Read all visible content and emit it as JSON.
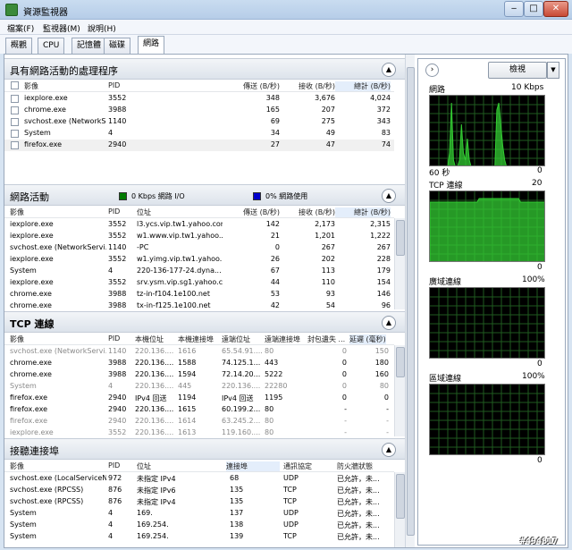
{
  "window": {
    "title": "資源監視器",
    "min": "‒",
    "max": "□",
    "close": "✕"
  },
  "menu": [
    "檔案(F)",
    "監視器(M)",
    "說明(H)"
  ],
  "tabs": [
    "概觀",
    "CPU",
    "記憶體",
    "磁碟",
    "網路"
  ],
  "sections": {
    "processes": {
      "title": "具有網路活動的處理程序",
      "columns": [
        "影像",
        "PID",
        "傳送 (B/秒)",
        "接收 (B/秒)",
        "總計 (B/秒)"
      ],
      "rows": [
        [
          "iexplore.exe",
          "3552",
          "348",
          "3,676",
          "4,024"
        ],
        [
          "chrome.exe",
          "3988",
          "165",
          "207",
          "372"
        ],
        [
          "svchost.exe (NetworkSe...",
          "1140",
          "69",
          "275",
          "343"
        ],
        [
          "System",
          "4",
          "34",
          "49",
          "83"
        ],
        [
          "firefox.exe",
          "2940",
          "27",
          "47",
          "74"
        ]
      ]
    },
    "network": {
      "title": "網路活動",
      "legend_io": "0 Kbps 網路 I/O",
      "legend_util": "0% 網路使用",
      "columns": [
        "影像",
        "PID",
        "位址",
        "傳送 (B/秒)",
        "接收 (B/秒)",
        "總計 (B/秒)"
      ],
      "rows": [
        [
          "iexplore.exe",
          "3552",
          "l3.ycs.vip.tw1.yahoo.com",
          "142",
          "2,173",
          "2,315"
        ],
        [
          "iexplore.exe",
          "3552",
          "w1.www.vip.tw1.yahoo....",
          "21",
          "1,201",
          "1,222"
        ],
        [
          "svchost.exe (NetworkServi...",
          "1140",
          "-PC",
          "0",
          "267",
          "267"
        ],
        [
          "iexplore.exe",
          "3552",
          "w1.yimg.vip.tw1.yahoo....",
          "26",
          "202",
          "228"
        ],
        [
          "System",
          "4",
          "220-136-177-24.dyna...",
          "67",
          "113",
          "179"
        ],
        [
          "iexplore.exe",
          "3552",
          "srv.ysm.vip.sg1.yahoo.c...",
          "44",
          "110",
          "154"
        ],
        [
          "chrome.exe",
          "3988",
          "tz-in-f104.1e100.net",
          "53",
          "93",
          "146"
        ],
        [
          "chrome.exe",
          "3988",
          "tx-in-f125.1e100.net",
          "42",
          "54",
          "96"
        ]
      ]
    },
    "tcp": {
      "title": "TCP 連線",
      "columns": [
        "影像",
        "PID",
        "本機位址",
        "本機連接埠",
        "遠端位址",
        "遠端連接埠",
        "封包遺失 ...",
        "延遲 (毫秒)"
      ],
      "rows": [
        {
          "cells": [
            "svchost.exe (NetworkServi...",
            "1140",
            "220.136....",
            "1616",
            "65.54.91....",
            "80",
            "0",
            "150"
          ],
          "gray": true
        },
        {
          "cells": [
            "chrome.exe",
            "3988",
            "220.136....",
            "1588",
            "74.125.1...",
            "443",
            "0",
            "180"
          ],
          "gray": false
        },
        {
          "cells": [
            "chrome.exe",
            "3988",
            "220.136....",
            "1594",
            "72.14.20...",
            "5222",
            "0",
            "160"
          ],
          "gray": false
        },
        {
          "cells": [
            "System",
            "4",
            "220.136....",
            "445",
            "220.136....",
            "22280",
            "0",
            "80"
          ],
          "gray": true
        },
        {
          "cells": [
            "firefox.exe",
            "2940",
            "IPv4 回送",
            "1194",
            "IPv4 回送",
            "1195",
            "0",
            "0"
          ],
          "gray": false
        },
        {
          "cells": [
            "firefox.exe",
            "2940",
            "220.136....",
            "1615",
            "60.199.2...",
            "80",
            "-",
            "-"
          ],
          "gray": false
        },
        {
          "cells": [
            "firefox.exe",
            "2940",
            "220.136....",
            "1614",
            "63.245.2...",
            "80",
            "-",
            "-"
          ],
          "gray": true
        },
        {
          "cells": [
            "iexplore.exe",
            "3552",
            "220.136....",
            "1613",
            "119.160....",
            "80",
            "-",
            "-"
          ],
          "gray": true
        }
      ]
    },
    "ports": {
      "title": "接聽連接埠",
      "columns": [
        "影像",
        "PID",
        "位址",
        "連接埠",
        "通訊協定",
        "防火牆狀態"
      ],
      "rows": [
        [
          "svchost.exe (LocalServiceN...",
          "972",
          "未指定 IPv4",
          "68",
          "UDP",
          "已允許，未..."
        ],
        [
          "svchost.exe (RPCSS)",
          "876",
          "未指定 IPv6",
          "135",
          "TCP",
          "已允許，未..."
        ],
        [
          "svchost.exe (RPCSS)",
          "876",
          "未指定 IPv4",
          "135",
          "TCP",
          "已允許，未..."
        ],
        [
          "System",
          "4",
          "169.",
          "137",
          "UDP",
          "已允許，未..."
        ],
        [
          "System",
          "4",
          "169.254.",
          "138",
          "UDP",
          "已允許，未..."
        ],
        [
          "System",
          "4",
          "169.254.",
          "139",
          "TCP",
          "已允許，未..."
        ]
      ]
    }
  },
  "right_pane": {
    "view_button": "檢視",
    "graphs": [
      {
        "name": "網路",
        "max": "10 Kbps",
        "time": "60 秒",
        "min": "0"
      },
      {
        "name": "TCP 連線",
        "max": "20",
        "time": "",
        "min": "0"
      },
      {
        "name": "廣域連線",
        "max": "100%",
        "time": "",
        "min": "0"
      },
      {
        "name": "區域連線",
        "max": "100%",
        "time": "",
        "min": "0"
      }
    ],
    "network_graph_values": [
      0,
      0,
      0,
      0,
      0,
      0,
      0,
      0,
      0,
      0,
      2,
      9,
      1,
      0,
      0,
      1,
      6,
      2,
      1,
      4,
      1,
      0,
      0,
      0,
      0,
      0,
      0,
      0,
      0,
      0,
      0,
      0,
      0,
      0,
      8,
      9,
      6,
      3,
      1,
      0,
      0,
      0,
      0,
      0,
      0,
      0,
      0,
      0,
      0,
      0,
      0,
      0,
      0,
      0,
      0,
      0,
      0,
      0,
      0,
      0
    ],
    "tcp_graph_values": [
      17,
      17,
      17,
      17,
      17,
      17,
      17,
      17,
      17,
      17,
      17,
      17,
      17,
      17,
      17,
      17,
      17,
      17,
      17,
      17,
      17,
      17,
      17,
      17,
      17,
      18,
      18,
      18,
      18,
      18,
      18,
      18,
      18,
      18,
      18,
      18,
      18,
      18,
      18,
      18,
      18,
      18,
      18,
      18,
      18,
      18,
      17,
      17,
      17,
      17,
      17,
      17,
      17,
      17,
      17,
      17,
      17,
      17,
      17,
      17
    ],
    "colors": {
      "graph_green": "#33cc33",
      "graph_bg": "#000000",
      "grid": "#1f5a1f",
      "io_legend": "#007a00",
      "util_legend": "#0000cc"
    }
  },
  "watermark": "#494817"
}
